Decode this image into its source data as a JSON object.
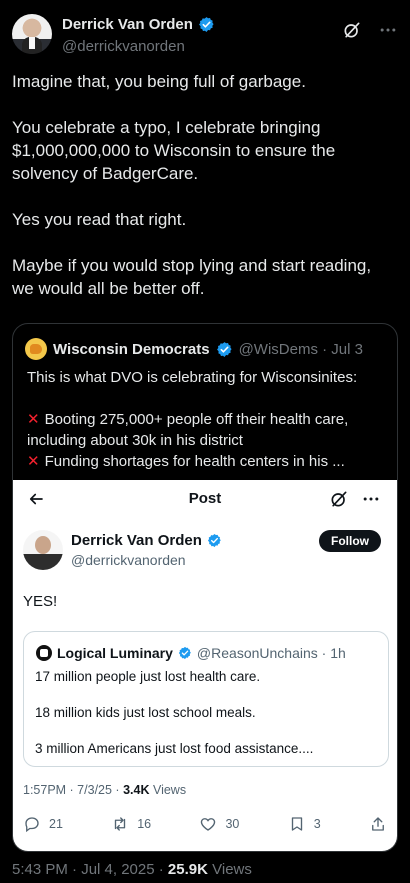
{
  "author": {
    "name": "Derrick Van Orden",
    "handle": "@derrickvanorden"
  },
  "tweet": {
    "paragraphs": [
      "Imagine that, you being full of garbage.",
      "You celebrate a typo, I celebrate bringing $1,000,000,000 to Wisconsin to ensure the solvency of BadgerCare.",
      "Yes you read that right.",
      "Maybe if you would stop lying and start reading, we would all be better off."
    ],
    "time": "5:43 PM · Jul 4, 2025 ·",
    "views_count": "25.9K",
    "views_label": "Views"
  },
  "quoted": {
    "name": "Wisconsin Democrats",
    "handle": "@WisDems · Jul 3",
    "lines": [
      "This is what DVO is celebrating for Wisconsinites:",
      "",
      "Booting 275,000+ people off their health care, including about 30k in his district",
      "Funding shortages for health centers in his ..."
    ]
  },
  "embedded": {
    "bar_title": "Post",
    "author_name": "Derrick Van Orden",
    "author_handle": "@derrickvanorden",
    "follow_label": "Follow",
    "body": "YES!",
    "inner_quote": {
      "name": "Logical Luminary",
      "handle": "@ReasonUnchains · 1h",
      "lines": [
        "17 million people just lost health care.",
        "18 million kids just lost school meals.",
        "3 million Americans just lost food assistance...."
      ]
    },
    "meta_time": "1:57PM · 7/3/25 ·",
    "meta_views_count": "3.4K",
    "meta_views_label": "Views",
    "stats": {
      "replies": "21",
      "reposts": "16",
      "likes": "30",
      "bookmarks": "3"
    }
  },
  "icons": {
    "verified": "verified-badge-icon",
    "grok": "grok-icon",
    "more": "more-icon",
    "back": "back-arrow-icon",
    "reply": "reply-icon",
    "repost": "repost-icon",
    "like": "heart-icon",
    "bookmark": "bookmark-icon",
    "share": "share-icon"
  },
  "colors": {
    "background": "#000000",
    "verified": "#1d9bf0",
    "secondary_text": "#71767b",
    "alert": "#f4212e"
  }
}
